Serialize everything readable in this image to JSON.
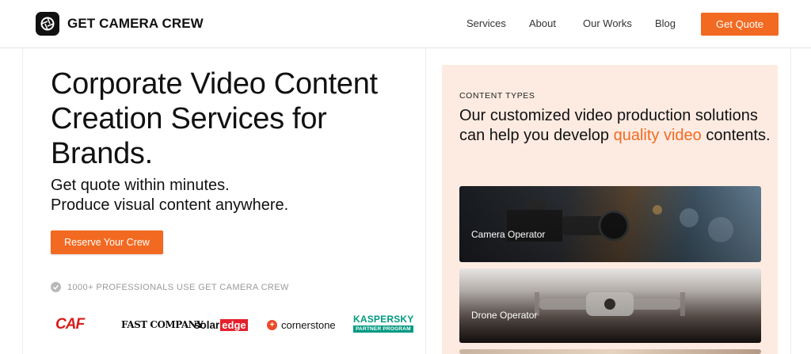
{
  "header": {
    "brand": "GET CAMERA CREW",
    "nav": [
      "Services",
      "About",
      "Our Works",
      "Blog"
    ],
    "cta": "Get Quote"
  },
  "hero": {
    "title": "Corporate Video Content Creation Services for Brands.",
    "subtitle_line1": "Get quote within minutes.",
    "subtitle_line2": "Produce visual content anywhere.",
    "cta": "Reserve Your Crew",
    "proof": "1000+ PROFESSIONALS USE GET CAMERA CREW"
  },
  "logos": {
    "caf": "CAF",
    "fastco": "FAST COMPANY",
    "solar_a": "solar",
    "solar_b": "edge",
    "corner": "cornerstone",
    "kasp_name": "KASPERSKY",
    "kasp_sub": "PARTNER PROGRAM"
  },
  "content": {
    "eyebrow": "CONTENT TYPES",
    "head_pre": "Our customized video production solutions can help you develop ",
    "head_accent": "quality video",
    "head_post": " contents.",
    "cards": [
      "Camera Operator",
      "Drone Operator"
    ]
  },
  "colors": {
    "accent": "#f26a21",
    "panel": "#fdebe2"
  }
}
